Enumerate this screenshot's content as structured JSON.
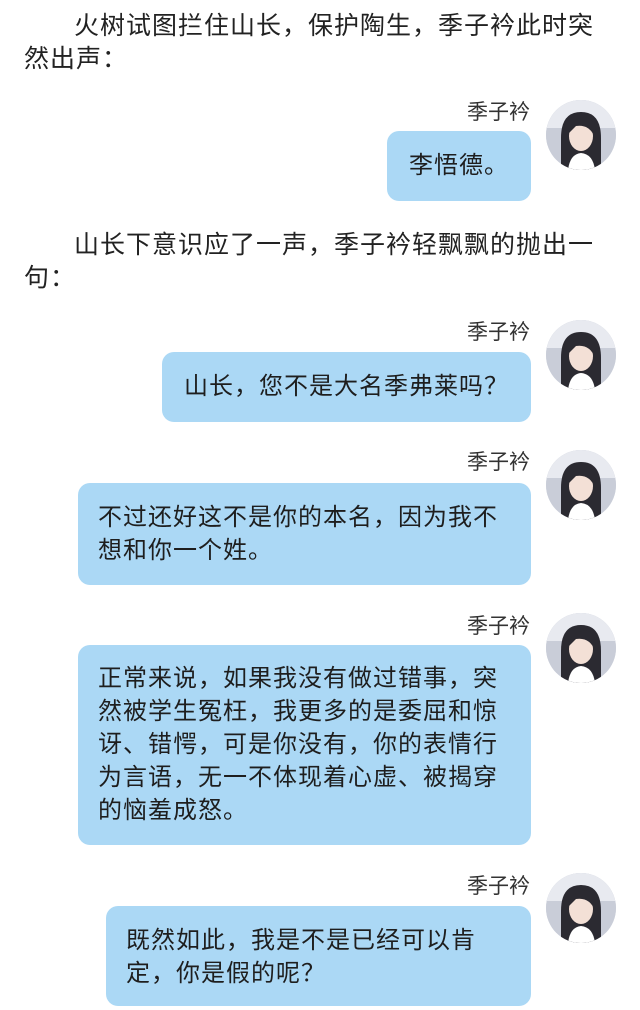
{
  "narration": [
    "火树试图拦住山长，保护陶生，季子衿此时突然出声：",
    "山长下意识应了一声，季子衿轻飘飘的抛出一句："
  ],
  "messages": [
    {
      "sender": "季子衿",
      "text": "李悟德。"
    },
    {
      "sender": "季子衿",
      "text": "山长，您不是大名季弗莱吗？"
    },
    {
      "sender": "季子衿",
      "text": "不过还好这不是你的本名，因为我不想和你一个姓。"
    },
    {
      "sender": "季子衿",
      "text": "正常来说，如果我没有做过错事，突然被学生冤枉，我更多的是委屈和惊讶、错愕，可是你没有，你的表情行为言语，无一不体现着心虚、被揭穿的恼羞成怒。"
    },
    {
      "sender": "季子衿",
      "text": "既然如此，我是不是已经可以肯定，你是假的呢？"
    }
  ],
  "colors": {
    "bubble": "#abd8f5",
    "text": "#222222"
  },
  "icons": {
    "avatar": "avatar-icon"
  }
}
